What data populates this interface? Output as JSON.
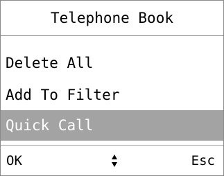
{
  "header": {
    "title": "Telephone Book"
  },
  "menu": {
    "items": [
      {
        "label": "Delete All",
        "selected": false
      },
      {
        "label": "Add To Filter",
        "selected": false
      },
      {
        "label": "Quick Call",
        "selected": true
      }
    ]
  },
  "softkeys": {
    "left_label": "OK",
    "center_icon": "up-down-arrows-icon",
    "right_label": "Esc"
  },
  "colors": {
    "selection_background": "#a3a3a3",
    "selection_text": "#ffffff",
    "divider": "#9a9a9a"
  }
}
